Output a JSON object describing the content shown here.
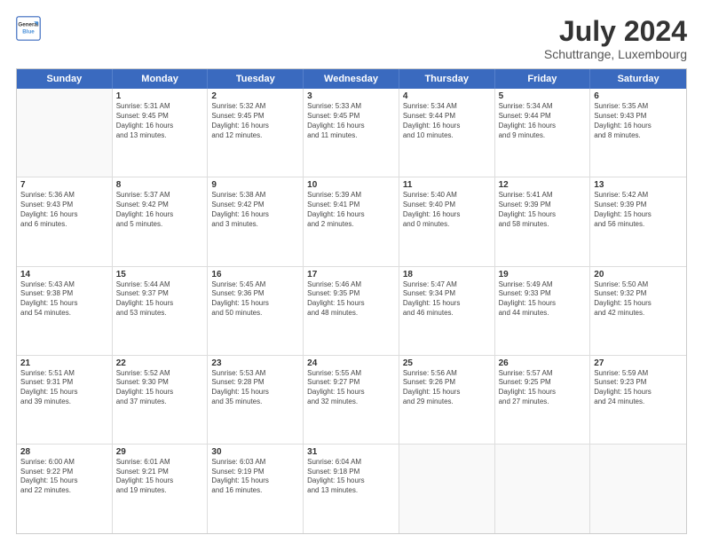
{
  "logo": {
    "line1": "General",
    "line2": "Blue"
  },
  "title": {
    "month_year": "July 2024",
    "location": "Schuttrange, Luxembourg"
  },
  "header_days": [
    "Sunday",
    "Monday",
    "Tuesday",
    "Wednesday",
    "Thursday",
    "Friday",
    "Saturday"
  ],
  "weeks": [
    [
      {
        "day": "",
        "text": ""
      },
      {
        "day": "1",
        "text": "Sunrise: 5:31 AM\nSunset: 9:45 PM\nDaylight: 16 hours\nand 13 minutes."
      },
      {
        "day": "2",
        "text": "Sunrise: 5:32 AM\nSunset: 9:45 PM\nDaylight: 16 hours\nand 12 minutes."
      },
      {
        "day": "3",
        "text": "Sunrise: 5:33 AM\nSunset: 9:45 PM\nDaylight: 16 hours\nand 11 minutes."
      },
      {
        "day": "4",
        "text": "Sunrise: 5:34 AM\nSunset: 9:44 PM\nDaylight: 16 hours\nand 10 minutes."
      },
      {
        "day": "5",
        "text": "Sunrise: 5:34 AM\nSunset: 9:44 PM\nDaylight: 16 hours\nand 9 minutes."
      },
      {
        "day": "6",
        "text": "Sunrise: 5:35 AM\nSunset: 9:43 PM\nDaylight: 16 hours\nand 8 minutes."
      }
    ],
    [
      {
        "day": "7",
        "text": "Sunrise: 5:36 AM\nSunset: 9:43 PM\nDaylight: 16 hours\nand 6 minutes."
      },
      {
        "day": "8",
        "text": "Sunrise: 5:37 AM\nSunset: 9:42 PM\nDaylight: 16 hours\nand 5 minutes."
      },
      {
        "day": "9",
        "text": "Sunrise: 5:38 AM\nSunset: 9:42 PM\nDaylight: 16 hours\nand 3 minutes."
      },
      {
        "day": "10",
        "text": "Sunrise: 5:39 AM\nSunset: 9:41 PM\nDaylight: 16 hours\nand 2 minutes."
      },
      {
        "day": "11",
        "text": "Sunrise: 5:40 AM\nSunset: 9:40 PM\nDaylight: 16 hours\nand 0 minutes."
      },
      {
        "day": "12",
        "text": "Sunrise: 5:41 AM\nSunset: 9:39 PM\nDaylight: 15 hours\nand 58 minutes."
      },
      {
        "day": "13",
        "text": "Sunrise: 5:42 AM\nSunset: 9:39 PM\nDaylight: 15 hours\nand 56 minutes."
      }
    ],
    [
      {
        "day": "14",
        "text": "Sunrise: 5:43 AM\nSunset: 9:38 PM\nDaylight: 15 hours\nand 54 minutes."
      },
      {
        "day": "15",
        "text": "Sunrise: 5:44 AM\nSunset: 9:37 PM\nDaylight: 15 hours\nand 53 minutes."
      },
      {
        "day": "16",
        "text": "Sunrise: 5:45 AM\nSunset: 9:36 PM\nDaylight: 15 hours\nand 50 minutes."
      },
      {
        "day": "17",
        "text": "Sunrise: 5:46 AM\nSunset: 9:35 PM\nDaylight: 15 hours\nand 48 minutes."
      },
      {
        "day": "18",
        "text": "Sunrise: 5:47 AM\nSunset: 9:34 PM\nDaylight: 15 hours\nand 46 minutes."
      },
      {
        "day": "19",
        "text": "Sunrise: 5:49 AM\nSunset: 9:33 PM\nDaylight: 15 hours\nand 44 minutes."
      },
      {
        "day": "20",
        "text": "Sunrise: 5:50 AM\nSunset: 9:32 PM\nDaylight: 15 hours\nand 42 minutes."
      }
    ],
    [
      {
        "day": "21",
        "text": "Sunrise: 5:51 AM\nSunset: 9:31 PM\nDaylight: 15 hours\nand 39 minutes."
      },
      {
        "day": "22",
        "text": "Sunrise: 5:52 AM\nSunset: 9:30 PM\nDaylight: 15 hours\nand 37 minutes."
      },
      {
        "day": "23",
        "text": "Sunrise: 5:53 AM\nSunset: 9:28 PM\nDaylight: 15 hours\nand 35 minutes."
      },
      {
        "day": "24",
        "text": "Sunrise: 5:55 AM\nSunset: 9:27 PM\nDaylight: 15 hours\nand 32 minutes."
      },
      {
        "day": "25",
        "text": "Sunrise: 5:56 AM\nSunset: 9:26 PM\nDaylight: 15 hours\nand 29 minutes."
      },
      {
        "day": "26",
        "text": "Sunrise: 5:57 AM\nSunset: 9:25 PM\nDaylight: 15 hours\nand 27 minutes."
      },
      {
        "day": "27",
        "text": "Sunrise: 5:59 AM\nSunset: 9:23 PM\nDaylight: 15 hours\nand 24 minutes."
      }
    ],
    [
      {
        "day": "28",
        "text": "Sunrise: 6:00 AM\nSunset: 9:22 PM\nDaylight: 15 hours\nand 22 minutes."
      },
      {
        "day": "29",
        "text": "Sunrise: 6:01 AM\nSunset: 9:21 PM\nDaylight: 15 hours\nand 19 minutes."
      },
      {
        "day": "30",
        "text": "Sunrise: 6:03 AM\nSunset: 9:19 PM\nDaylight: 15 hours\nand 16 minutes."
      },
      {
        "day": "31",
        "text": "Sunrise: 6:04 AM\nSunset: 9:18 PM\nDaylight: 15 hours\nand 13 minutes."
      },
      {
        "day": "",
        "text": ""
      },
      {
        "day": "",
        "text": ""
      },
      {
        "day": "",
        "text": ""
      }
    ]
  ]
}
